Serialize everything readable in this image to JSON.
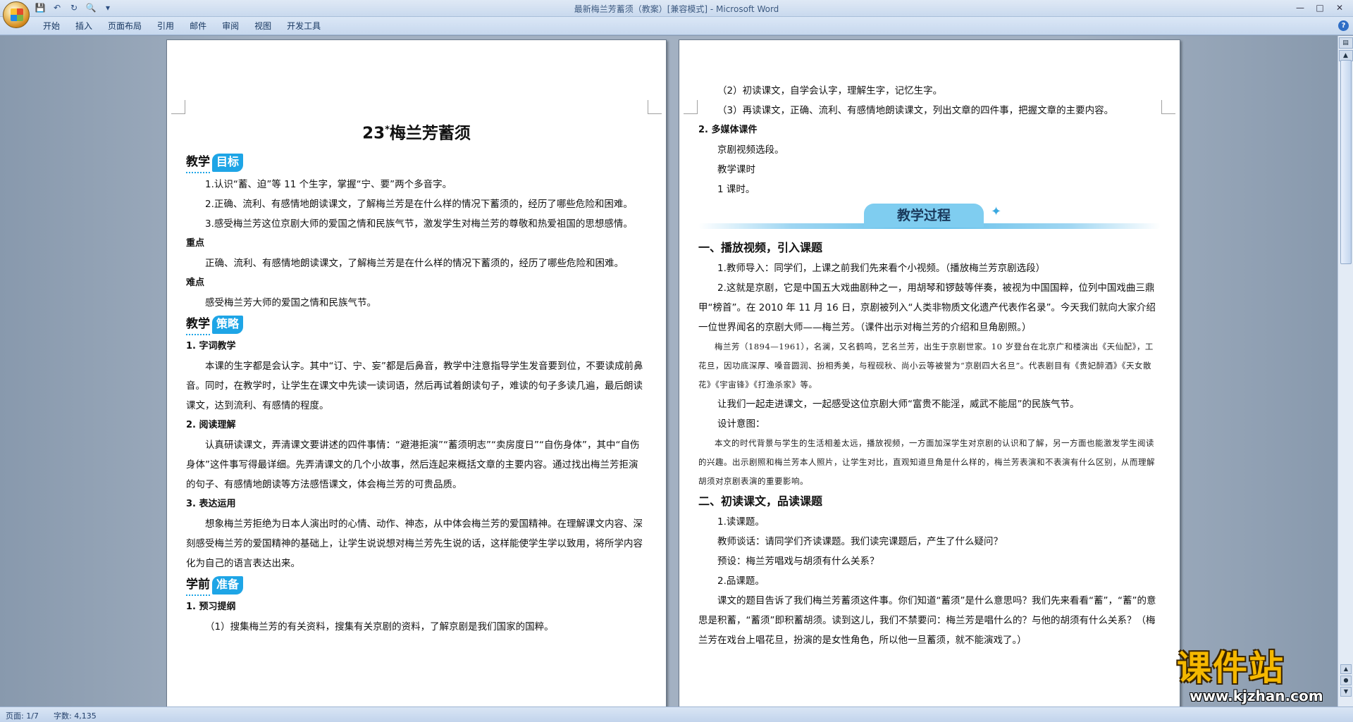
{
  "window": {
    "title": "最新梅兰芳蓄须（教案）[兼容模式] - Microsoft Word"
  },
  "quick_access": {
    "save_icon": "save-icon",
    "undo_icon": "undo-icon",
    "redo_icon": "redo-icon",
    "print_preview_icon": "print-preview-icon"
  },
  "ribbon": {
    "tabs": [
      "开始",
      "插入",
      "页面布局",
      "引用",
      "邮件",
      "审阅",
      "视图",
      "开发工具"
    ]
  },
  "page1": {
    "title_num": "23",
    "title_star": "*",
    "title_text": "梅兰芳蓄须",
    "sec1_a": "教学",
    "sec1_b": "目标",
    "goal1": "1.认识“蓄、迫”等 11 个生字，掌握“宁、要”两个多音字。",
    "goal2": "2.正确、流利、有感情地朗读课文，了解梅兰芳是在什么样的情况下蓄须的，经历了哪些危险和困难。",
    "goal3": "3.感受梅兰芳这位京剧大师的爱国之情和民族气节，激发学生对梅兰芳的尊敬和热爱祖国的思想感情。",
    "key_label": "重点",
    "key_text": "正确、流利、有感情地朗读课文，了解梅兰芳是在什么样的情况下蓄须的，经历了哪些危险和困难。",
    "diff_label": "难点",
    "diff_text": "感受梅兰芳大师的爱国之情和民族气节。",
    "sec2_a": "教学",
    "sec2_b": "策略",
    "s1_label": "1. 字词教学",
    "s1_text": "本课的生字都是会认字。其中“订、宁、妄”都是后鼻音，教学中注意指导学生发音要到位，不要读成前鼻音。同时，在教学时，让学生在课文中先读一读词语，然后再试着朗读句子，难读的句子多读几遍，最后朗读课文，达到流利、有感情的程度。",
    "s2_label": "2. 阅读理解",
    "s2_text": "认真研读课文，弄清课文要讲述的四件事情：“避港拒演”“蓄须明志”“卖房度日”“自伤身体”，其中“自伤身体”这件事写得最详细。先弄清课文的几个小故事，然后连起来概括文章的主要内容。通过找出梅兰芳拒演的句子、有感情地朗读等方法感悟课文，体会梅兰芳的可贵品质。",
    "s3_label": "3. 表达运用",
    "s3_text": "想象梅兰芳拒绝为日本人演出时的心情、动作、神态，从中体会梅兰芳的爱国精神。在理解课文内容、深刻感受梅兰芳的爱国精神的基础上，让学生说说想对梅兰芳先生说的话，这样能使学生学以致用，将所学内容化为自己的语言表达出来。",
    "sec3_a": "学前",
    "sec3_b": "准备",
    "p1_label": "1. 预习提纲",
    "p1_text": "（1）搜集梅兰芳的有关资料，搜集有关京剧的资料，了解京剧是我们国家的国粹。"
  },
  "page2": {
    "l1": "（2）初读课文，自学会认字，理解生字，记忆生字。",
    "l2": "（3）再读课文，正确、流利、有感情地朗读课文，列出文章的四件事，把握文章的主要内容。",
    "media_label": "2. 多媒体课件",
    "media_text": "京剧视频选段。",
    "hours_label": "教学课时",
    "hours_text": "1 课时。",
    "banner": "教学过程",
    "part1": "一、播放视频，引入课题",
    "p1_1": "1.教师导入：同学们，上课之前我们先来看个小视频。（播放梅兰芳京剧选段）",
    "p1_2": "2.这就是京剧，它是中国五大戏曲剧种之一，用胡琴和锣鼓等伴奏，被视为中国国粹，位列中国戏曲三鼎甲“榜首”。在 2010 年 11 月 16 日，京剧被列入“人类非物质文化遗产代表作名录”。今天我们就向大家介绍一位世界闻名的京剧大师——梅兰芳。（课件出示对梅兰芳的介绍和旦角剧照。）",
    "note1": "梅兰芳（1894—1961），名澜，又名鹤鸣，艺名兰芳，出生于京剧世家。10 岁登台在北京广和楼演出《天仙配》，工花旦，因功底深厚、嗓音圆润、扮相秀美，与程砚秋、尚小云等被誉为“京剧四大名旦”。代表剧目有《贵妃醉酒》《天女散花》《宇宙锋》《打渔杀家》等。",
    "p1_3": "让我们一起走进课文，一起感受这位京剧大师“富贵不能淫，威武不能屈”的民族气节。",
    "design_label": "设计意图：",
    "note2": "本文的时代背景与学生的生活相差太远，播放视频，一方面加深学生对京剧的认识和了解，另一方面也能激发学生阅读的兴趣。出示剧照和梅兰芳本人照片，让学生对比，直观知道旦角是什么样的，梅兰芳表演和不表演有什么区别，从而理解胡须对京剧表演的重要影响。",
    "part2": "二、初读课文，品读课题",
    "p2_1": "1.读课题。",
    "p2_2": "教师谈话：请同学们齐读课题。我们读完课题后，产生了什么疑问？",
    "p2_3": "预设：梅兰芳唱戏与胡须有什么关系？",
    "p2_4": "2.品课题。",
    "p2_5": "课文的题目告诉了我们梅兰芳蓄须这件事。你们知道“蓄须”是什么意思吗？我们先来看看“蓄”，“蓄”的意思是积蓄，“蓄须”即积蓄胡须。读到这儿，我们不禁要问：梅兰芳是唱什么的？与他的胡须有什么关系？（梅兰芳在戏台上唱花旦，扮演的是女性角色，所以他一旦蓄须，就不能演戏了。）"
  },
  "status": {
    "page": "页面: 1/7",
    "words": "字数: 4,135"
  },
  "watermark": {
    "text": "课件站",
    "url": "www.kjzhan.com"
  },
  "colors": {
    "accent": "#1ea5e6",
    "ribbon": "#c7d8ee",
    "workspace": "#a3b1c2"
  }
}
